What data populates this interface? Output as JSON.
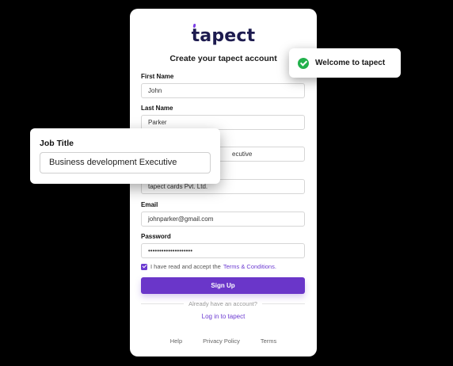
{
  "brand": {
    "logo_text": "tapect",
    "accent_color": "#6a36c9"
  },
  "form": {
    "title": "Create your tapect account",
    "first_name": {
      "label": "First Name",
      "value": "John"
    },
    "last_name": {
      "label": "Last Name",
      "value": "Parker"
    },
    "job_title_partial": "ecutive",
    "company_value": "tapect cards Pvt. Ltd.",
    "email": {
      "label": "Email",
      "value": "johnparker@gmail.com"
    },
    "password": {
      "label": "Password",
      "value": "••••••••••••••••••••"
    },
    "terms_text": "I have read and accept the",
    "terms_link": "Terms & Conditions.",
    "signup_button": "Sign Up",
    "already_text": "Already have an account?",
    "login_link": "Log in to tapect"
  },
  "footer": {
    "help": "Help",
    "privacy": "Privacy Policy",
    "terms": "Terms"
  },
  "toast": {
    "message": "Welcome to tapect",
    "status_color": "#22b14c"
  },
  "job_card": {
    "label": "Job Title",
    "value": "Business development Executive"
  }
}
